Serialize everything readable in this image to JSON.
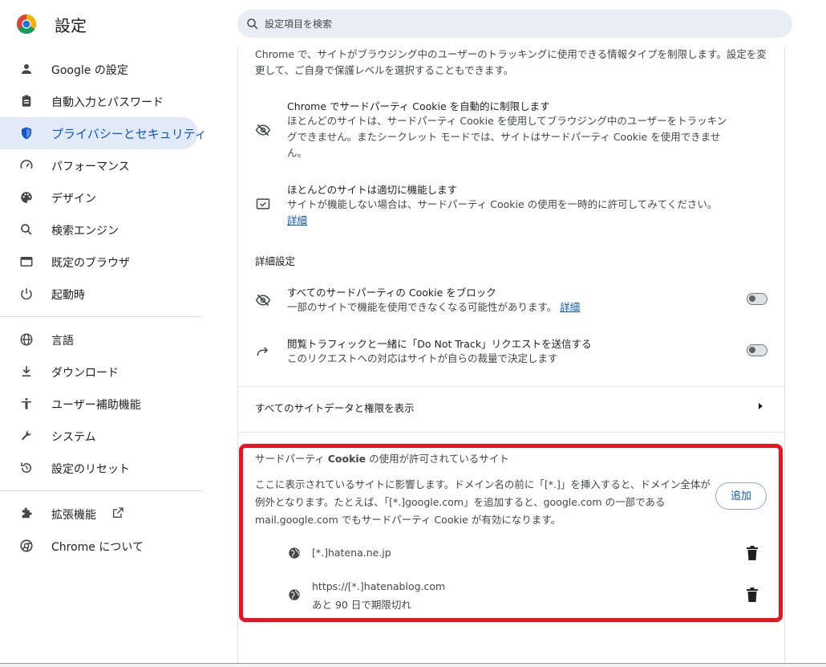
{
  "header": {
    "title": "設定",
    "search_placeholder": "設定項目を検索"
  },
  "sidebar": {
    "items": [
      {
        "label": "Google の設定",
        "icon": "person-icon"
      },
      {
        "label": "自動入力とパスワード",
        "icon": "clipboard-icon"
      },
      {
        "label": "プライバシーとセキュリティ",
        "icon": "shield-icon"
      },
      {
        "label": "パフォーマンス",
        "icon": "speedometer-icon"
      },
      {
        "label": "デザイン",
        "icon": "palette-icon"
      },
      {
        "label": "検索エンジン",
        "icon": "search-icon"
      },
      {
        "label": "既定のブラウザ",
        "icon": "browser-icon"
      },
      {
        "label": "起動時",
        "icon": "power-icon"
      },
      {
        "label": "言語",
        "icon": "globe-icon"
      },
      {
        "label": "ダウンロード",
        "icon": "download-icon"
      },
      {
        "label": "ユーザー補助機能",
        "icon": "accessibility-icon"
      },
      {
        "label": "システム",
        "icon": "wrench-icon"
      },
      {
        "label": "設定のリセット",
        "icon": "reset-icon"
      },
      {
        "label": "拡張機能",
        "icon": "puzzle-icon"
      },
      {
        "label": "Chrome について",
        "icon": "chrome-icon"
      }
    ]
  },
  "main": {
    "intro": "Chrome で、サイトがブラウジング中のユーザーのトラッキングに使用できる情報タイプを制限します。設定を変更して、ご自身で保護レベルを選択することもできます。",
    "limit": {
      "title": "Chrome でサードパーティ Cookie を自動的に制限します",
      "desc": "ほとんどのサイトは、サードパーティ Cookie を使用してブラウジング中のユーザーをトラッキングできません。またシークレット モードでは、サイトはサードパーティ Cookie を使用できません。"
    },
    "works": {
      "title": "ほとんどのサイトは適切に機能します",
      "desc": "サイトが機能しない場合は、サードパーティ Cookie の使用を一時的に許可してみてください。",
      "link": "詳細"
    },
    "advanced_heading": "詳細設定",
    "block_all": {
      "title": "すべてのサードパーティの Cookie をブロック",
      "desc": "一部のサイトで機能を使用できなくなる可能性があります。",
      "link": "詳細",
      "enabled": false
    },
    "dnt": {
      "title": "閲覧トラフィックと一緒に「Do Not Track」リクエストを送信する",
      "desc": "このリクエストへの対応はサイトが自らの裁量で決定します",
      "enabled": false
    },
    "all_site_data": "すべてのサイトデータと権限を表示",
    "allowed": {
      "title_prefix": "サードパーティ ",
      "title_bold": "Cookie",
      "title_suffix": " の使用が許可されているサイト",
      "desc": "ここに表示されているサイトに影響します。ドメイン名の前に「[*.]」を挿入すると、ドメイン全体が例外となります。たとえば、「[*.]google.com」を追加すると、google.com の一部であるmail.google.com でもサードパーティ Cookie が有効になります。",
      "add_label": "追加",
      "sites": [
        {
          "url": "[*.]hatena.ne.jp",
          "expiry": ""
        },
        {
          "url": "https://[*.]hatenablog.com",
          "expiry": "あと 90 日で期限切れ"
        }
      ]
    }
  },
  "colors": {
    "accent": "#0b57d0",
    "highlight": "#e8141f",
    "active_bg": "#e3eaf7"
  }
}
